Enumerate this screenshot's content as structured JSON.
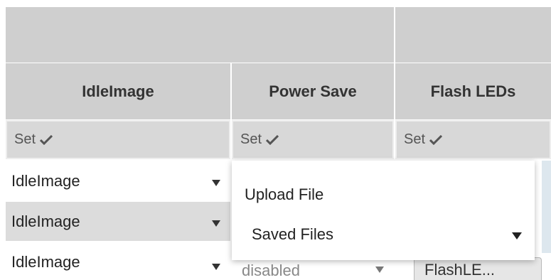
{
  "columns": [
    {
      "label": "IdleImage"
    },
    {
      "label": "Power Save"
    },
    {
      "label": "Flash LEDs"
    }
  ],
  "set_row": [
    {
      "label": "Set"
    },
    {
      "label": "Set"
    },
    {
      "label": "Set"
    }
  ],
  "rows": [
    {
      "value": "IdleImage"
    },
    {
      "value": "IdleImage"
    },
    {
      "value": "IdleImage"
    }
  ],
  "power_save_select": {
    "value": "disabled"
  },
  "flash_button": {
    "label": "FlashLE..."
  },
  "menu": {
    "upload_label": "Upload File",
    "saved_label": "Saved Files"
  },
  "icons": {
    "check": "checkmark-icon",
    "caret": "chevron-down-icon"
  }
}
